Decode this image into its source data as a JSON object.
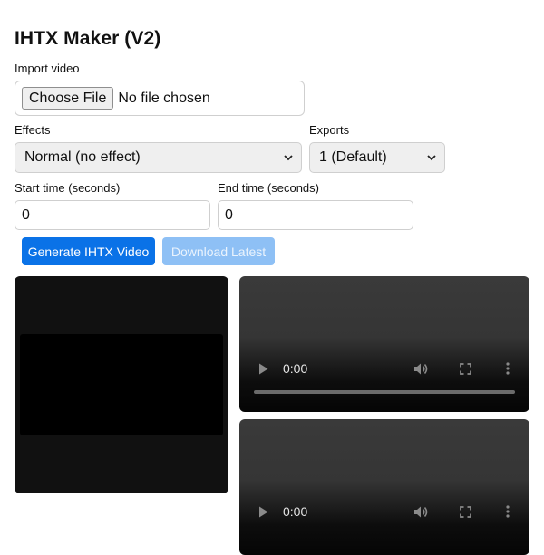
{
  "app": {
    "title": "IHTX Maker (V2)"
  },
  "import": {
    "label": "Import video",
    "button_label": "Choose File",
    "status": "No file chosen"
  },
  "effects": {
    "label": "Effects",
    "selected": "Normal (no effect)"
  },
  "exports": {
    "label": "Exports",
    "selected": "1 (Default)"
  },
  "start_time": {
    "label": "Start time (seconds)",
    "value": "0"
  },
  "end_time": {
    "label": "End time (seconds)",
    "value": "0"
  },
  "actions": {
    "generate_label": "Generate IHTX Video",
    "download_label": "Download Latest"
  },
  "videos": [
    {
      "time": "0:00",
      "icons": [
        "play-icon",
        "volume-icon",
        "fullscreen-icon",
        "more-options-icon"
      ]
    },
    {
      "time": "0:00",
      "icons": [
        "play-icon",
        "volume-icon",
        "fullscreen-icon",
        "more-options-icon"
      ]
    }
  ],
  "colors": {
    "primary": "#0a72e7",
    "primary_disabled": "#8ec0f5",
    "preview_bg": "#111111"
  }
}
